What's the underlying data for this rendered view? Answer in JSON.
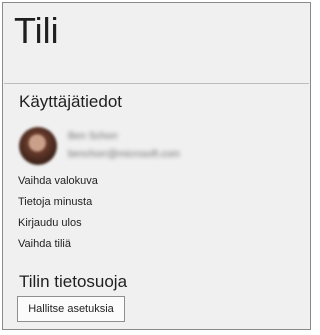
{
  "page": {
    "title": "Tili"
  },
  "user_info": {
    "heading": "Käyttäjätiedot",
    "name": "Ben Schorr",
    "email": "benchorr@microsoft.com",
    "links": [
      {
        "label": "Vaihda valokuva"
      },
      {
        "label": "Tietoja minusta"
      },
      {
        "label": "Kirjaudu ulos"
      },
      {
        "label": "Vaihda tiliä"
      }
    ]
  },
  "privacy": {
    "heading": "Tilin tietosuoja",
    "button_label": "Hallitse asetuksia"
  }
}
